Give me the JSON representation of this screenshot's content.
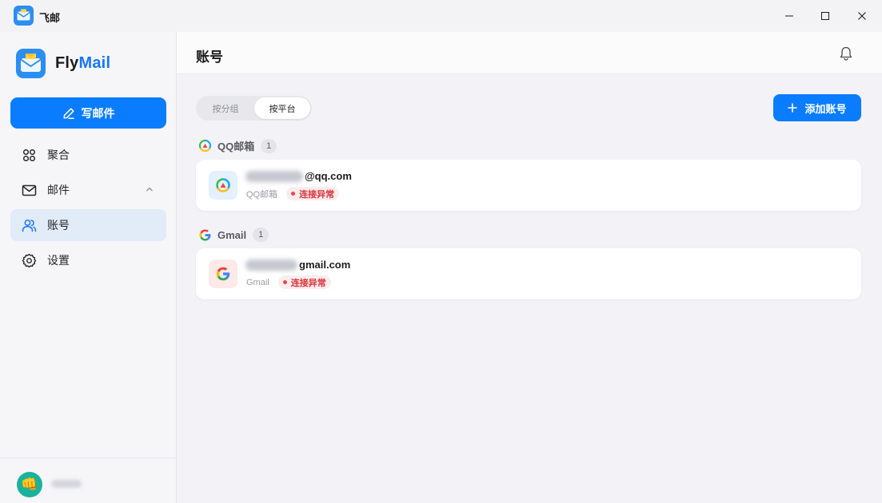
{
  "window": {
    "title": "飞邮",
    "minimize_icon": "minimize-icon",
    "maximize_icon": "maximize-icon",
    "close_icon": "close-icon"
  },
  "sidebar": {
    "brand": {
      "part1": "Fly",
      "part2": "Mail",
      "logo_icon": "mail-envelope-icon"
    },
    "compose_label": "写邮件",
    "items": [
      {
        "label": "聚合",
        "icon": "grid-icon",
        "active": false
      },
      {
        "label": "邮件",
        "icon": "mail-icon",
        "active": false,
        "expanded": true
      },
      {
        "label": "账号",
        "icon": "users-icon",
        "active": true
      },
      {
        "label": "设置",
        "icon": "gear-icon",
        "active": false
      }
    ],
    "user": {
      "avatar_emoji": "👊"
    }
  },
  "main": {
    "title": "账号",
    "bell_icon": "bell-icon",
    "segments": [
      {
        "label": "按分组",
        "selected": false
      },
      {
        "label": "按平台",
        "selected": true
      }
    ],
    "add_label": "添加账号",
    "groups": [
      {
        "name": "QQ邮箱",
        "count": "1",
        "accounts": [
          {
            "email_visible": "@qq.com",
            "provider": "QQ邮箱",
            "status": "连接异常"
          }
        ]
      },
      {
        "name": "Gmail",
        "count": "1",
        "accounts": [
          {
            "email_visible": "gmail.com",
            "provider": "Gmail",
            "status": "连接异常"
          }
        ]
      }
    ]
  },
  "colors": {
    "accent": "#0a7cff",
    "brand_mail": "#1677ff",
    "error": "#d9363e",
    "active_nav_bg": "#e2ebf8"
  }
}
